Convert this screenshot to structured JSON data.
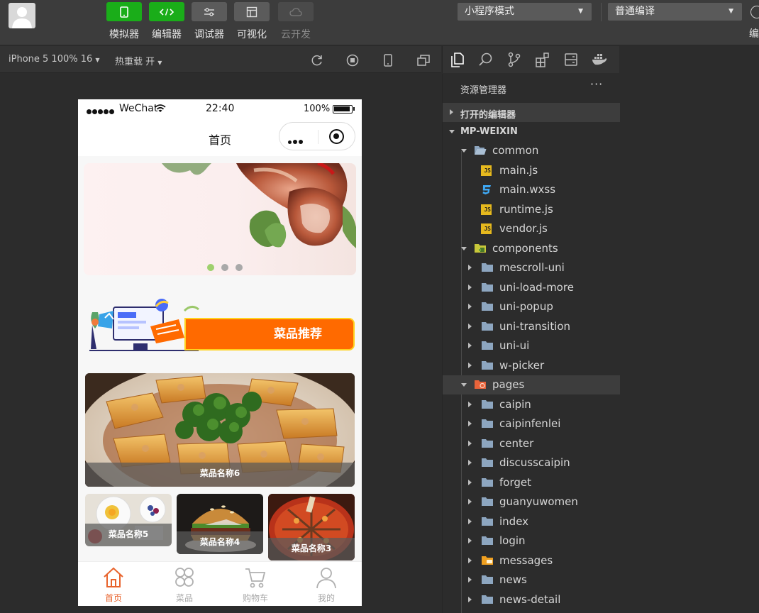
{
  "toolbar": {
    "buttons": [
      {
        "label": "模拟器",
        "icon": "phone-icon"
      },
      {
        "label": "编辑器",
        "icon": "code-icon"
      },
      {
        "label": "调试器",
        "icon": "sliders-icon"
      },
      {
        "label": "可视化",
        "icon": "layout-icon"
      },
      {
        "label": "云开发",
        "icon": "cloud-icon"
      }
    ],
    "mode_select": "小程序模式",
    "compile_select": "普通编译",
    "far_right_label": "编"
  },
  "simulator_bar": {
    "device": "iPhone 5 100% 16",
    "hot_reload": "热重载 开"
  },
  "phone": {
    "status": {
      "carrier": "WeChat",
      "time": "22:40",
      "battery": "100%"
    },
    "nav_title": "首页",
    "recommend_title": "菜品推荐",
    "featured_dish": "菜品名称6",
    "dishes": [
      "菜品名称5",
      "菜品名称4",
      "菜品名称3"
    ],
    "tabs": [
      {
        "label": "首页",
        "icon": "home-icon"
      },
      {
        "label": "菜品",
        "icon": "grid-icon"
      },
      {
        "label": "购物车",
        "icon": "cart-icon"
      },
      {
        "label": "我的",
        "icon": "user-icon"
      }
    ]
  },
  "explorer": {
    "title": "资源管理器",
    "more": "···",
    "open_editors": "打开的编辑器",
    "root": "MP-WEIXIN",
    "tree": [
      {
        "name": "common",
        "type": "folder-open",
        "depth": 1
      },
      {
        "name": "main.js",
        "type": "js",
        "depth": 2
      },
      {
        "name": "main.wxss",
        "type": "css",
        "depth": 2
      },
      {
        "name": "runtime.js",
        "type": "js",
        "depth": 2
      },
      {
        "name": "vendor.js",
        "type": "js",
        "depth": 2
      },
      {
        "name": "components",
        "type": "folder-components",
        "depth": 1
      },
      {
        "name": "mescroll-uni",
        "type": "folder",
        "depth": 2
      },
      {
        "name": "uni-load-more",
        "type": "folder",
        "depth": 2
      },
      {
        "name": "uni-popup",
        "type": "folder",
        "depth": 2
      },
      {
        "name": "uni-transition",
        "type": "folder",
        "depth": 2
      },
      {
        "name": "uni-ui",
        "type": "folder",
        "depth": 2
      },
      {
        "name": "w-picker",
        "type": "folder",
        "depth": 2
      },
      {
        "name": "pages",
        "type": "folder-pages",
        "depth": 1
      },
      {
        "name": "caipin",
        "type": "folder",
        "depth": 2
      },
      {
        "name": "caipinfenlei",
        "type": "folder",
        "depth": 2
      },
      {
        "name": "center",
        "type": "folder",
        "depth": 2
      },
      {
        "name": "discusscaipin",
        "type": "folder",
        "depth": 2
      },
      {
        "name": "forget",
        "type": "folder",
        "depth": 2
      },
      {
        "name": "guanyuwomen",
        "type": "folder",
        "depth": 2
      },
      {
        "name": "index",
        "type": "folder",
        "depth": 2
      },
      {
        "name": "login",
        "type": "folder",
        "depth": 2
      },
      {
        "name": "messages",
        "type": "folder-messages",
        "depth": 2
      },
      {
        "name": "news",
        "type": "folder",
        "depth": 2
      },
      {
        "name": "news-detail",
        "type": "folder",
        "depth": 2
      }
    ]
  }
}
